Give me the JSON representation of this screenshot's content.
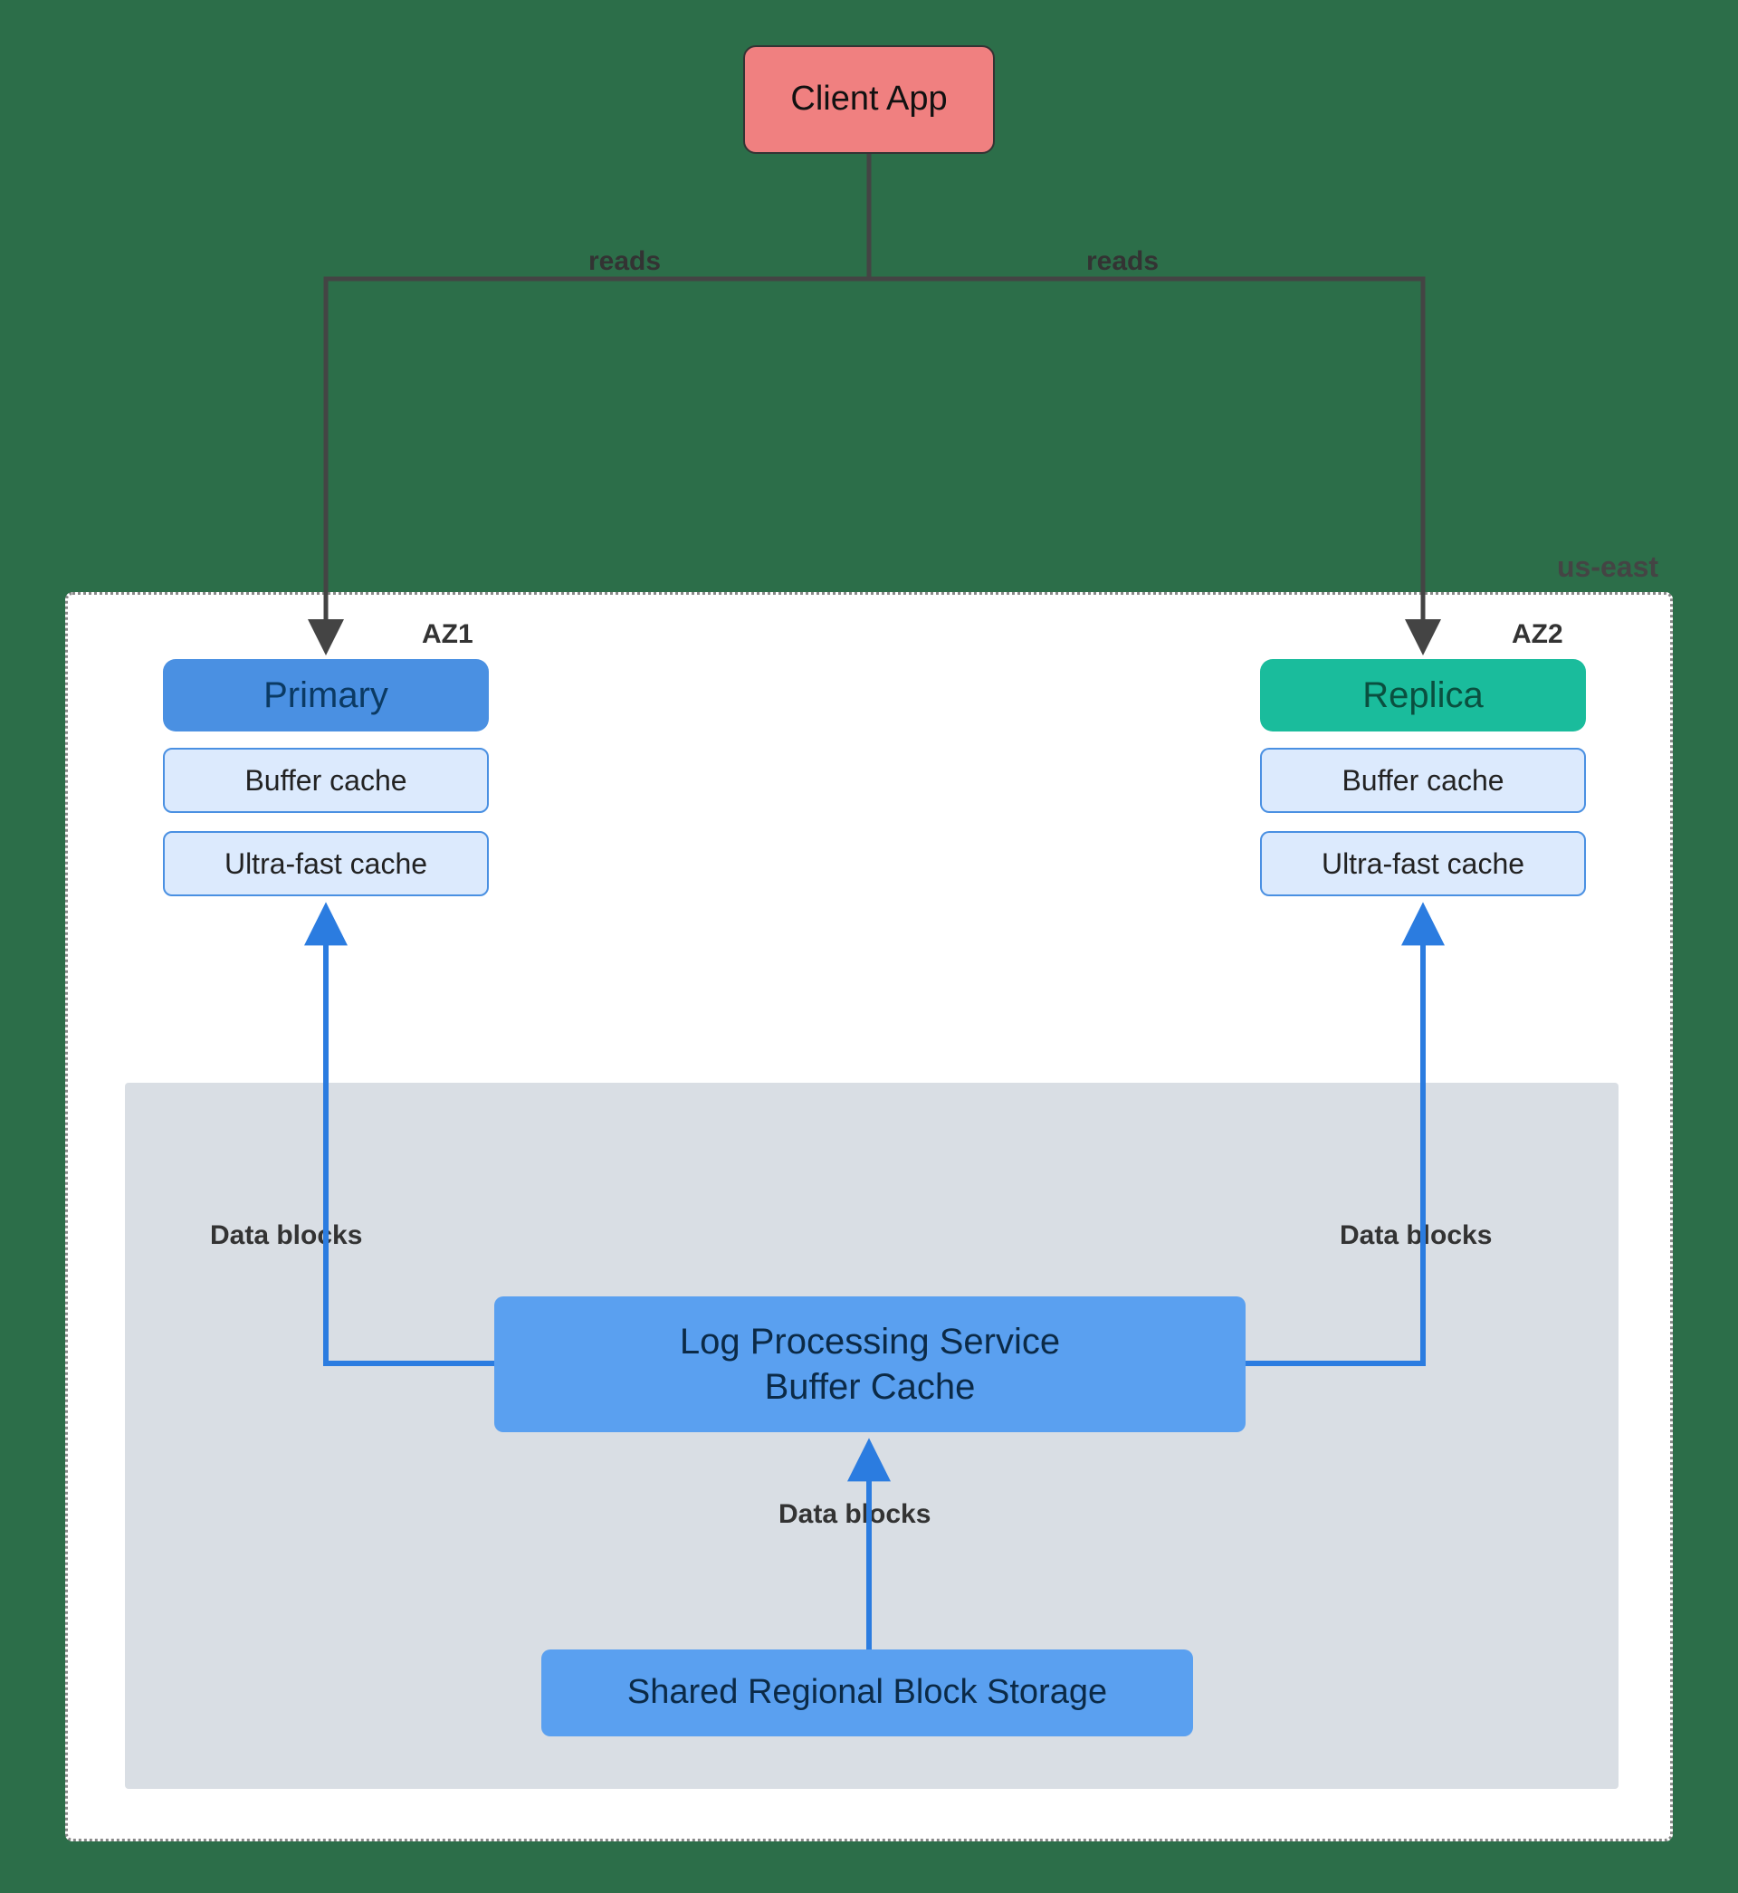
{
  "client": {
    "label": "Client App"
  },
  "region": {
    "label": "us-east"
  },
  "az1": {
    "label": "AZ1",
    "primary": "Primary",
    "buffer": "Buffer cache",
    "ultra": "Ultra-fast cache"
  },
  "az2": {
    "label": "AZ2",
    "replica": "Replica",
    "buffer": "Buffer cache",
    "ultra": "Ultra-fast cache"
  },
  "edges": {
    "reads_left": "reads",
    "reads_right": "reads",
    "blocks_left": "Data blocks",
    "blocks_right": "Data blocks",
    "blocks_mid": "Data blocks"
  },
  "lps_line1": "Log Processing Service",
  "lps_line2": "Buffer Cache",
  "storage": "Shared Regional Block Storage",
  "colors": {
    "bg": "#2c6e49",
    "client": "#f08080",
    "primary": "#4a90e2",
    "replica": "#1abc9c",
    "cache_fill": "#dceafd",
    "lps": "#5aa0f0",
    "storage": "#5aa0f0",
    "arrow_dark": "#444",
    "arrow_blue": "#2b7ce0"
  }
}
